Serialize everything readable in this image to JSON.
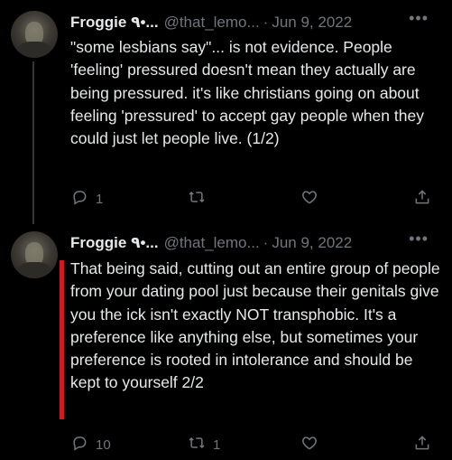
{
  "tweets": [
    {
      "author_name": "Froggie ٩•...",
      "handle": "@that_lemo...",
      "separator": "·",
      "date": "Jun 9, 2022",
      "more": "•••",
      "text": "\"some lesbians say\"... is not evidence. People 'feeling' pressured doesn't mean they actually are being pressured. it's like christians going on about feeling 'pressured' to accept gay people when they could just let people live. (1/2)",
      "replies": "1",
      "retweets": "",
      "likes": "",
      "icons": [
        "reply-icon",
        "retweet-icon",
        "like-icon",
        "share-icon"
      ]
    },
    {
      "author_name": "Froggie ٩•...",
      "handle": "@that_lemo...",
      "separator": "·",
      "date": "Jun 9, 2022",
      "more": "•••",
      "text": "That being said, cutting out an entire group of people from your dating pool just because their genitals give you the ick isn't exactly NOT transphobic. It's a preference like anything else, but sometimes your preference is rooted in intolerance and should be kept to yourself 2/2",
      "replies": "10",
      "retweets": "1",
      "likes": "",
      "highlight_color": "#e0121b",
      "icons": [
        "reply-icon",
        "retweet-icon",
        "like-icon",
        "share-icon"
      ]
    }
  ],
  "colors": {
    "background": "#000000",
    "text": "#e7e9ea",
    "muted": "#71767b",
    "highlight": "#e0121b"
  }
}
